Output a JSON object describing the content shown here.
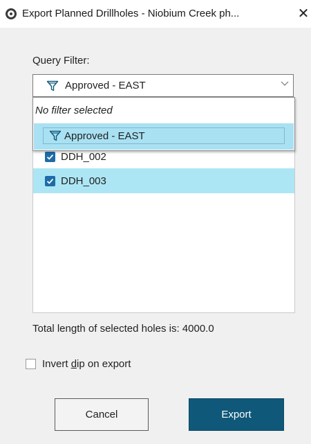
{
  "window": {
    "title": "Export Planned Drillholes - Niobium Creek ph...",
    "close_glyph": "✕"
  },
  "query_filter": {
    "label": "Query Filter:",
    "selected": "Approved - EAST",
    "options": [
      "No filter selected",
      "Approved - EAST"
    ]
  },
  "holes": [
    {
      "name": "DDH_002",
      "checked": true,
      "selected": false
    },
    {
      "name": "DDH_003",
      "checked": true,
      "selected": true
    }
  ],
  "total_length_text": "Total length of selected holes is: 4000.0",
  "invert_dip": {
    "label_prefix": "Invert ",
    "label_mnemonic": "d",
    "label_suffix": "ip on export",
    "checked": false
  },
  "buttons": {
    "cancel": "Cancel",
    "export": "Export"
  },
  "colors": {
    "accent": "#0f5879",
    "selection": "#ace6f4",
    "checkbox": "#1d6ca8"
  },
  "icons": {
    "app": "app-logo-icon",
    "filter": "filter-funnel-icon",
    "chevron": "chevron-down-icon",
    "check": "check-icon"
  }
}
